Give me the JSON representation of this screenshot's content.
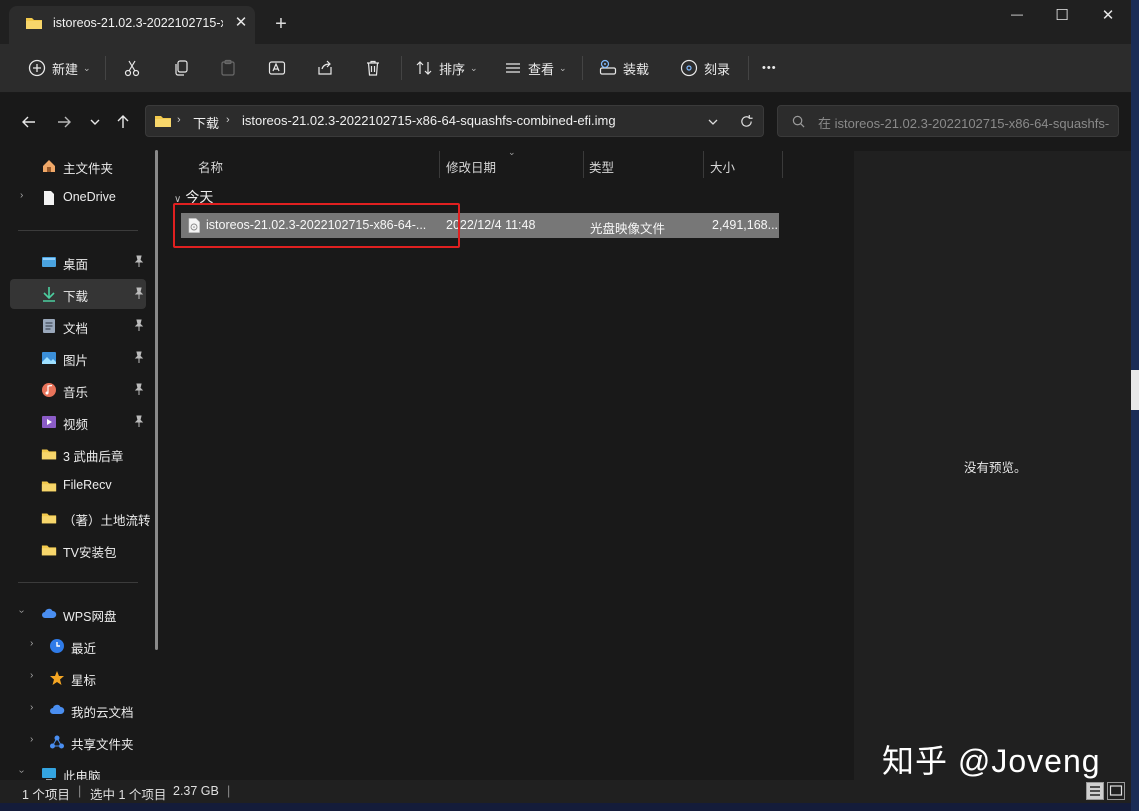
{
  "window": {
    "tab_title": "istoreos-21.02.3-2022102715-x",
    "tab_close": "✕",
    "tab_add": "+",
    "minimize": "—",
    "maximize": "☐",
    "close": "✕"
  },
  "toolbar": {
    "new_label": "新建",
    "sort_label": "排序",
    "view_label": "查看",
    "mount_label": "装载",
    "burn_label": "刻录",
    "more_label": "•••"
  },
  "address": {
    "crumbs": [
      "下载",
      "istoreos-21.02.3-2022102715-x86-64-squashfs-combined-efi.img"
    ],
    "search_placeholder": "在 istoreos-21.02.3-2022102715-x86-64-squashfs-..."
  },
  "sidebar": {
    "items": [
      {
        "label": "主文件夹",
        "icon": "home-icon"
      },
      {
        "label": "OneDrive",
        "icon": "document-icon"
      },
      {
        "label": "桌面",
        "icon": "desktop-icon",
        "pinned": true
      },
      {
        "label": "下载",
        "icon": "download-icon",
        "pinned": true,
        "selected": true
      },
      {
        "label": "文档",
        "icon": "document-icon",
        "pinned": true
      },
      {
        "label": "图片",
        "icon": "image-icon",
        "pinned": true
      },
      {
        "label": "音乐",
        "icon": "music-icon",
        "pinned": true
      },
      {
        "label": "视频",
        "icon": "video-icon",
        "pinned": true
      },
      {
        "label": "3 武曲后章",
        "icon": "folder-icon"
      },
      {
        "label": "FileRecv",
        "icon": "folder-icon"
      },
      {
        "label": "（著）土地流转",
        "icon": "folder-icon"
      },
      {
        "label": "TV安装包",
        "icon": "folder-icon"
      },
      {
        "label": "WPS网盘",
        "icon": "cloud-icon"
      },
      {
        "label": "最近",
        "icon": "clock-icon"
      },
      {
        "label": "星标",
        "icon": "star-icon"
      },
      {
        "label": "我的云文档",
        "icon": "cloud-icon"
      },
      {
        "label": "共享文件夹",
        "icon": "share-icon"
      },
      {
        "label": "此电脑",
        "icon": "pc-icon"
      }
    ]
  },
  "filelist": {
    "columns": [
      "名称",
      "修改日期",
      "类型",
      "大小"
    ],
    "group_label": "今天",
    "rows": [
      {
        "name": "istoreos-21.02.3-2022102715-x86-64-...",
        "date": "2022/12/4 11:48",
        "type": "光盘映像文件",
        "size": "2,491,168..."
      }
    ]
  },
  "preview": {
    "empty_text": "没有预览。"
  },
  "watermark": "知乎 @Joveng",
  "statusbar": {
    "item_count": "1 个项目",
    "selection": "选中 1 个项目",
    "size": "2.37 GB",
    "bar": "|"
  },
  "colors": {
    "selection_row": "#777777",
    "highlight_box": "#e02020",
    "folder": "#f2c94c"
  }
}
